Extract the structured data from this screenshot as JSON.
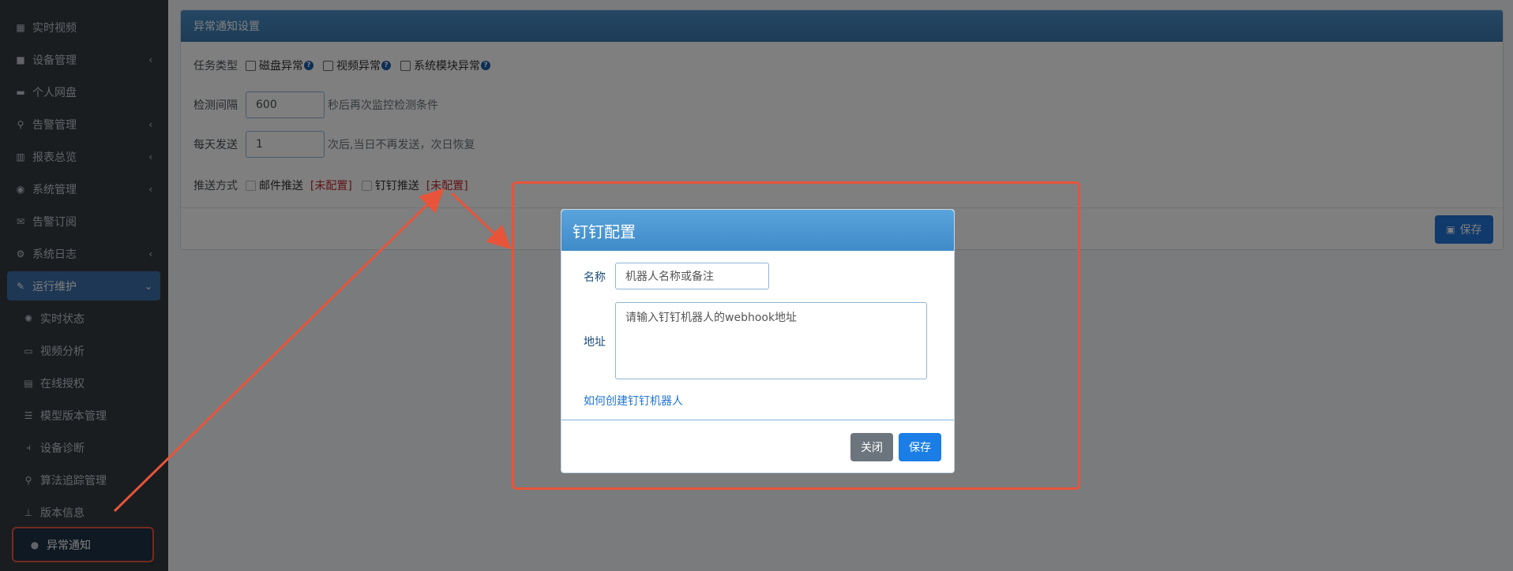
{
  "sidebar": {
    "items": [
      {
        "label": "实时视频",
        "icon": "film-icon",
        "chevron": ""
      },
      {
        "label": "设备管理",
        "icon": "video-camera-icon",
        "chevron": "‹"
      },
      {
        "label": "个人网盘",
        "icon": "hdd-icon",
        "chevron": ""
      },
      {
        "label": "告警管理",
        "icon": "search-icon",
        "chevron": "‹"
      },
      {
        "label": "报表总览",
        "icon": "bar-chart-icon",
        "chevron": "‹"
      },
      {
        "label": "系统管理",
        "icon": "user-circle-icon",
        "chevron": "‹"
      },
      {
        "label": "告警订阅",
        "icon": "envelope-icon",
        "chevron": ""
      },
      {
        "label": "系统日志",
        "icon": "gears-icon",
        "chevron": "‹"
      },
      {
        "label": "运行维护",
        "icon": "wrench-icon",
        "chevron": "⌄"
      }
    ],
    "sub_items": [
      {
        "label": "实时状态",
        "icon": "spinner-icon"
      },
      {
        "label": "视频分析",
        "icon": "monitor-icon"
      },
      {
        "label": "在线授权",
        "icon": "id-card-icon"
      },
      {
        "label": "模型版本管理",
        "icon": "database-icon"
      },
      {
        "label": "设备诊断",
        "icon": "thermometer-icon"
      },
      {
        "label": "算法追踪管理",
        "icon": "map-marker-icon"
      },
      {
        "label": "版本信息",
        "icon": "sitemap-icon"
      },
      {
        "label": "异常通知",
        "icon": "comments-icon"
      }
    ]
  },
  "card": {
    "title": "异常通知设置",
    "task_type_label": "任务类型",
    "task_types": [
      "磁盘异常",
      "视频异常",
      "系统模块异常"
    ],
    "interval_label": "检测间隔",
    "interval_value": "600",
    "interval_hint": "秒后再次监控检测条件",
    "daily_label": "每天发送",
    "daily_value": "1",
    "daily_hint": "次后,当日不再发送，次日恢复",
    "push_label": "推送方式",
    "push_email": "邮件推送",
    "push_email_status": "[未配置]",
    "push_dingtalk": "钉钉推送",
    "push_dingtalk_status": "[未配置]",
    "save_label": "保存"
  },
  "modal": {
    "title": "钉钉配置",
    "name_label": "名称",
    "name_placeholder": "机器人名称或备注",
    "address_label": "地址",
    "address_placeholder": "请输入钉钉机器人的webhook地址",
    "help_link": "如何创建钉钉机器人",
    "close_label": "关闭",
    "save_label": "保存"
  },
  "colors": {
    "sidebar_bg": "#343a40",
    "header_blue": "#3c8dbc",
    "primary": "#1a7ee6",
    "annotation_red": "#e8543a",
    "warning_red": "#c0262d"
  }
}
